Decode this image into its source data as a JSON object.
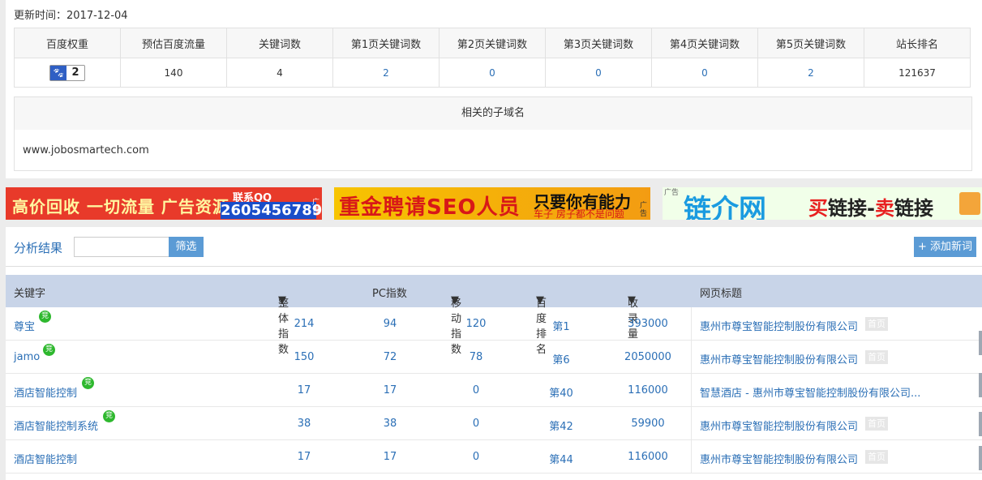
{
  "update_label": "更新时间：2017-12-04",
  "stats": {
    "headers": [
      "百度权重",
      "预估百度流量",
      "关键词数",
      "第1页关键词数",
      "第2页关键词数",
      "第3页关键词数",
      "第4页关键词数",
      "第5页关键词数",
      "站长排名"
    ],
    "weight": "2",
    "values": [
      "140",
      "4",
      "2",
      "0",
      "0",
      "0",
      "2",
      "121637"
    ]
  },
  "subdomains": {
    "heading": "相关的子域名",
    "items": [
      "www.jobosmartech.com"
    ]
  },
  "banners": {
    "b1": {
      "text": "高价回收 一切流量 广告资源",
      "qq_label": "联系QQ",
      "qq_number": "2605456789",
      "ad": "广告"
    },
    "b2": {
      "title": "重金聘请SEO人员",
      "slogan": "只要你有能力",
      "sub": "车子 房子都不是问题",
      "ad": "广告"
    },
    "b3": {
      "ad": "广告",
      "logo": "链介网",
      "text_buy": "买",
      "text_mid": "链接-",
      "text_sell": "卖",
      "text_end": "链接"
    }
  },
  "analysis": {
    "title": "分析结果",
    "filter_button": "筛选",
    "add_button": "+ 添加新词",
    "columns": [
      "关键字",
      "整体指数",
      "PC指数",
      "移动指数",
      "百度排名",
      "收录量",
      "网页标题"
    ],
    "bid_icon_text": "竞",
    "home_tag": "首页",
    "rows": [
      {
        "keyword": "尊宝",
        "overall": "214",
        "pc": "94",
        "mobile": "120",
        "rank": "第1",
        "indexed": "393000",
        "title": "惠州市尊宝智能控制股份有限公司",
        "bid": true,
        "home": true
      },
      {
        "keyword": "jamo",
        "overall": "150",
        "pc": "72",
        "mobile": "78",
        "rank": "第6",
        "indexed": "2050000",
        "title": "惠州市尊宝智能控制股份有限公司",
        "bid": true,
        "home": true
      },
      {
        "keyword": "酒店智能控制",
        "overall": "17",
        "pc": "17",
        "mobile": "0",
        "rank": "第40",
        "indexed": "116000",
        "title": "智慧酒店 - 惠州市尊宝智能控制股份有限公司...",
        "bid": true,
        "home": false
      },
      {
        "keyword": "酒店智能控制系统",
        "overall": "38",
        "pc": "38",
        "mobile": "0",
        "rank": "第42",
        "indexed": "59900",
        "title": "惠州市尊宝智能控制股份有限公司",
        "bid": true,
        "home": true
      },
      {
        "keyword": "酒店智能控制",
        "overall": "17",
        "pc": "17",
        "mobile": "0",
        "rank": "第44",
        "indexed": "116000",
        "title": "惠州市尊宝智能控制股份有限公司",
        "bid": false,
        "home": true
      }
    ]
  }
}
